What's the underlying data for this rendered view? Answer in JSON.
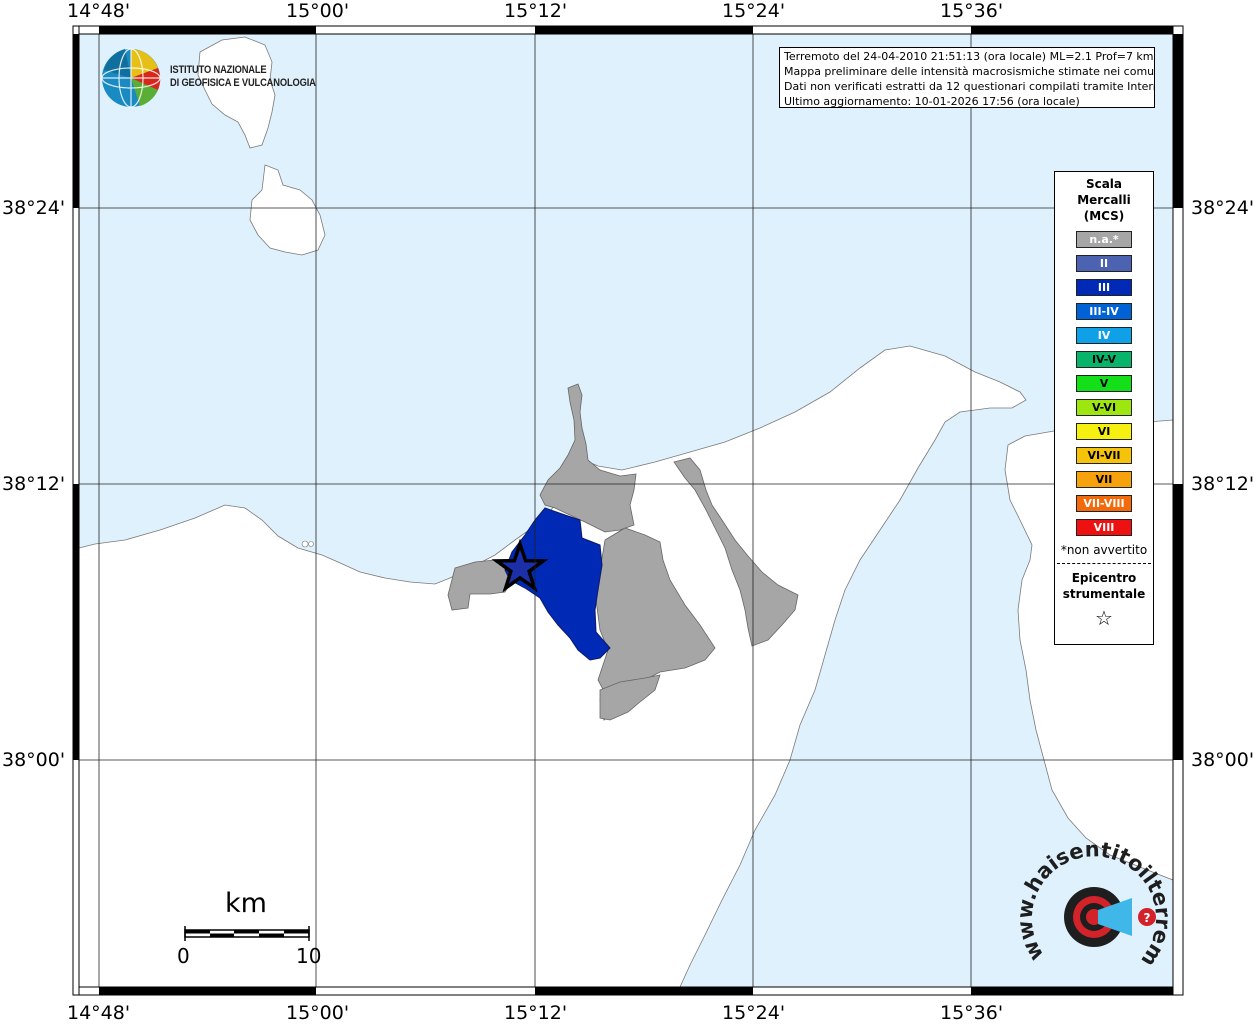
{
  "map": {
    "lon_labels": [
      "14°48'",
      "15°00'",
      "15°12'",
      "15°24'",
      "15°36'"
    ],
    "lat_labels": [
      "38°24'",
      "38°12'",
      "38°00'"
    ],
    "colors": {
      "sea": "#dff1fc",
      "land": "#ffffff",
      "not_felt": "#a6a6a6",
      "intensity_III": "#0029b5",
      "epicenter_fill": "#1c2fa8"
    }
  },
  "info": {
    "line1": "Terremoto del 24-04-2010 21:51:13 (ora locale) ML=2.1 Prof=7 km",
    "line2": "Mappa preliminare delle intensità macrosismiche stimate nei comuni",
    "line3": "Dati non verificati estratti da 12 questionari compilati tramite Internet.",
    "line4": "Ultimo aggiornamento: 10-01-2026 17:56 (ora locale)"
  },
  "logo": {
    "line1": "ISTITUTO NAZIONALE",
    "line2": "DI GEOFISICA E VULCANOLOGIA"
  },
  "legend": {
    "title_line1": "Scala",
    "title_line2": "Mercalli",
    "title_line3": "(MCS)",
    "items": [
      {
        "label": "n.a.*",
        "color": "#a6a6a6"
      },
      {
        "label": "II",
        "color": "#4b63b0"
      },
      {
        "label": "III",
        "color": "#0029b5"
      },
      {
        "label": "III-IV",
        "color": "#0062d4"
      },
      {
        "label": "IV",
        "color": "#0fa0e8"
      },
      {
        "label": "IV-V",
        "color": "#07b46a"
      },
      {
        "label": "V",
        "color": "#14e01a"
      },
      {
        "label": "V-VI",
        "color": "#9ee60f"
      },
      {
        "label": "VI",
        "color": "#f5f00f"
      },
      {
        "label": "VI-VII",
        "color": "#f5c30a"
      },
      {
        "label": "VII",
        "color": "#f7a10d"
      },
      {
        "label": "VII-VIII",
        "color": "#f26a0a"
      },
      {
        "label": "VIII",
        "color": "#ee1111"
      }
    ],
    "note": "*non avvertito",
    "epicenter_line1": "Epicentro",
    "epicenter_line2": "strumentale",
    "star": "☆"
  },
  "scalebar": {
    "unit": "km",
    "start": "0",
    "end": "10"
  },
  "watermark": {
    "text": "www.haisentitoilterremoto.it",
    "icon": "earthquake-target-logo-icon",
    "accent": "#d2232a"
  }
}
